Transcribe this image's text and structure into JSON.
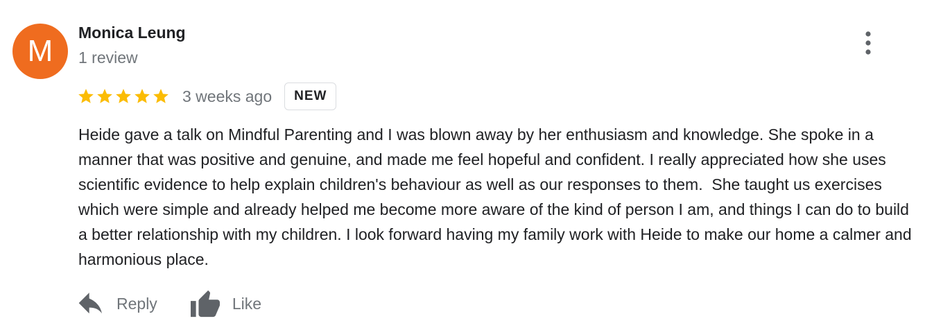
{
  "review": {
    "author": {
      "initial": "M",
      "name": "Monica Leung",
      "meta": "1 review",
      "avatar_color": "#ef6c1f"
    },
    "menu_icon": "more-vert-icon",
    "rating": {
      "stars": 5,
      "max_stars": 5,
      "star_color": "#fbbc04",
      "time_ago": "3 weeks ago",
      "badge": "NEW"
    },
    "text": "Heide gave a talk on Mindful Parenting and I was blown away by her enthusiasm and knowledge. She spoke in a manner that was positive and genuine, and made me feel hopeful and confident. I really appreciated how she uses scientific evidence to help explain children's behaviour as well as our responses to them.  She taught us exercises which were simple and already helped me become more aware of the kind of person I am, and things I can do to build a better relationship with my children. I look forward having my family work with Heide to make our home a calmer and harmonious place.",
    "actions": {
      "reply_label": "Reply",
      "reply_icon": "reply-arrow-icon",
      "like_label": "Like",
      "like_icon": "thumbs-up-icon"
    }
  }
}
